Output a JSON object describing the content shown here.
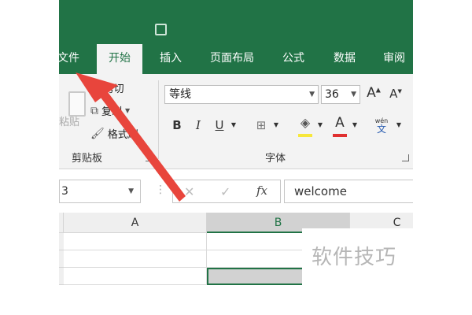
{
  "tabs": [
    "文件",
    "开始",
    "插入",
    "页面布局",
    "公式",
    "数据",
    "审阅"
  ],
  "active_tab": "开始",
  "clipboard": {
    "paste_label": "粘贴",
    "cut_label": "剪切",
    "copy_label": "复制",
    "format_painter_label": "格式刷",
    "group_label": "剪贴板"
  },
  "font": {
    "name": "等线",
    "size": "36",
    "grow_label": "A",
    "shrink_label": "A",
    "bold_label": "B",
    "italic_label": "I",
    "underline_label": "U",
    "font_color_label": "A",
    "phonetic_top": "wén",
    "phonetic_bottom": "文",
    "group_label": "字体"
  },
  "formula_bar": {
    "name_box": "3",
    "cancel_glyph": "✕",
    "enter_glyph": "✓",
    "fx_label": "fx",
    "value": "welcome"
  },
  "columns": [
    "A",
    "B",
    "C"
  ],
  "selected_column": "B",
  "watermark": "软件技巧",
  "colors": {
    "excel_green": "#217346",
    "annotation_red": "#e8453c",
    "font_color": "#e03030",
    "highlight": "#f7e73b"
  }
}
